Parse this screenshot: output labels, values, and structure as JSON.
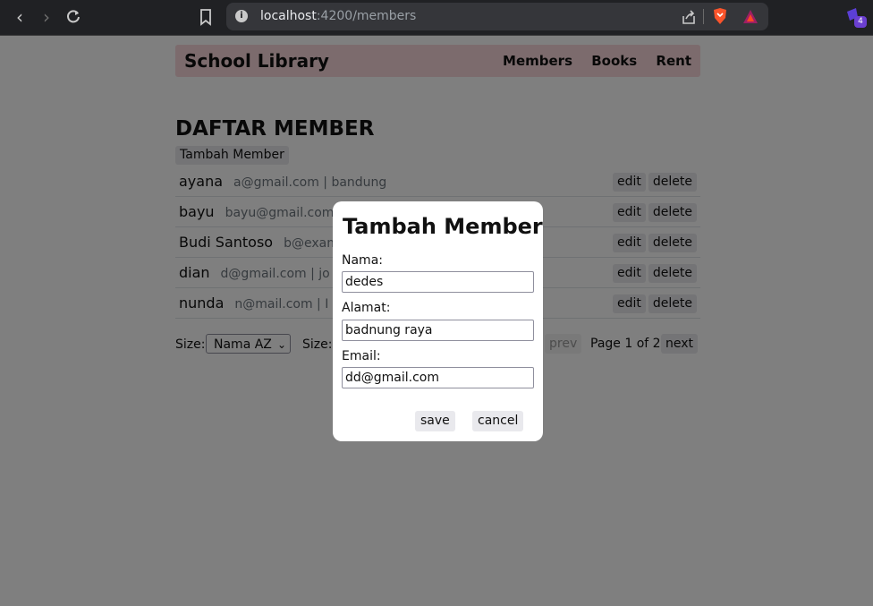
{
  "browser": {
    "url_host": "localhost",
    "url_path": ":4200/members",
    "extension_badge": "4"
  },
  "navbar": {
    "brand": "School Library",
    "links": [
      "Members",
      "Books",
      "Rent"
    ],
    "background": "#f8d7da"
  },
  "main": {
    "title": "DAFTAR MEMBER",
    "add_button": "Tambah Member",
    "members": [
      {
        "name": "ayana",
        "detail": "a@gmail.com | bandung"
      },
      {
        "name": "bayu",
        "detail": "bayu@gmail.com"
      },
      {
        "name": "Budi Santoso",
        "detail": "b@exam"
      },
      {
        "name": "dian",
        "detail": "d@gmail.com | jo"
      },
      {
        "name": "nunda",
        "detail": "n@mail.com | I"
      }
    ],
    "row_actions": {
      "edit": "edit",
      "delete": "delete"
    },
    "footer": {
      "size_label_1": "Size:",
      "sort_select": "Nama AZ",
      "size_label_2": "Size:",
      "prev": "prev",
      "page_info": "Page 1 of 2",
      "next": "next"
    }
  },
  "modal": {
    "title": "Tambah Member",
    "fields": [
      {
        "label": "Nama:",
        "value": "dedes"
      },
      {
        "label": "Alamat:",
        "value": "badnung raya"
      },
      {
        "label": "Email:",
        "value": "dd@gmail.com"
      }
    ],
    "save": "save",
    "cancel": "cancel"
  }
}
